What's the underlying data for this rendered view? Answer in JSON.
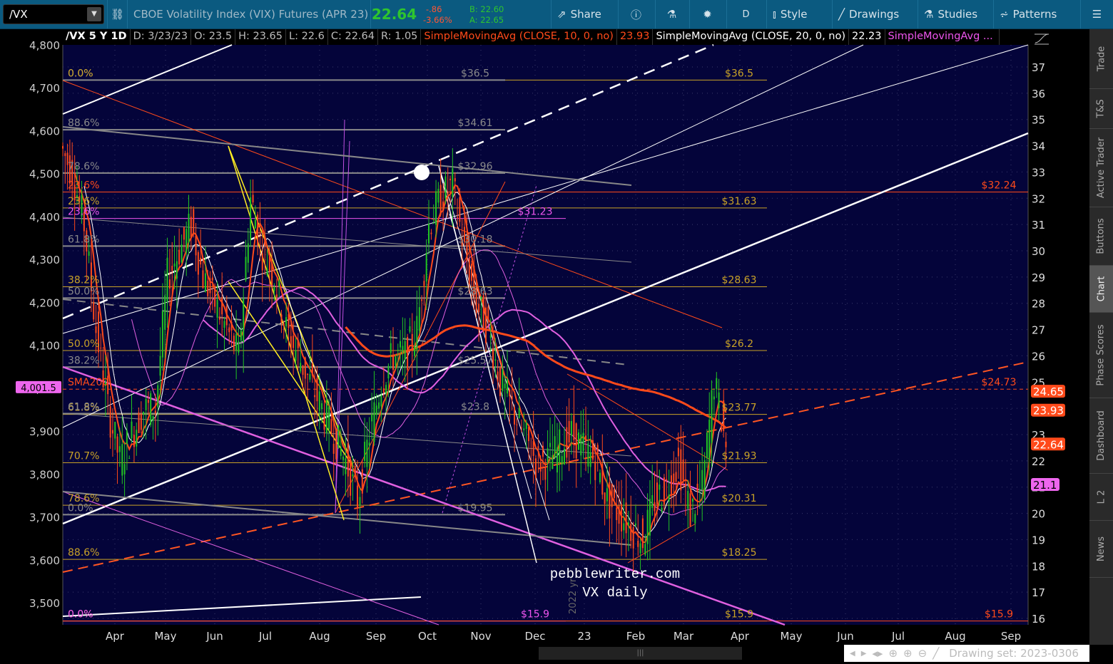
{
  "toolbar": {
    "symbol": "/VX",
    "description": "CBOE Volatility Index (VIX) Futures (APR 23)",
    "last": "22.64",
    "change": "-.86",
    "change_pct": "-3.66%",
    "bid": "B: 22.60",
    "ask": "A: 22.65",
    "share": "Share",
    "aggregation": "D",
    "style": "Style",
    "drawings": "Drawings",
    "studies": "Studies",
    "patterns": "Patterns"
  },
  "header": {
    "title": "/VX 5 Y 1D",
    "date": "D: 3/23/23",
    "open": "O: 23.5",
    "high": "H: 23.65",
    "low": "L: 22.6",
    "close": "C: 22.64",
    "range": "R: 1.05",
    "sma10_label": "SimpleMovingAvg (CLOSE, 10, 0, no)",
    "sma10_value": "23.93",
    "sma20_label": "SimpleMovingAvg (CLOSE, 20, 0, no)",
    "sma20_value": "22.23",
    "sma3_label": "SimpleMovingAvg ..."
  },
  "sidebar": [
    "Trade",
    "T&S",
    "Active Trader",
    "Buttons",
    "Chart",
    "Phase Scores",
    "Dashboard",
    "L 2",
    "News"
  ],
  "bottom": {
    "drawing_set": "Drawing set: 2023-0306"
  },
  "colors": {
    "bg": "#04043a",
    "up": "#22c322",
    "down": "#ff4a1a",
    "sma10": "#ff4a1a",
    "sma20": "#ffffff",
    "sma_magenta": "#e060e0",
    "fib_gold": "#c9a227",
    "fib_gray": "#8a8a8a"
  },
  "chart_data": {
    "type": "candlestick",
    "title": "/VX 5 Y 1D",
    "annotations": {
      "watermark": "pebblewriter.com",
      "subtitle": "VX daily",
      "year_marker": "2022 yr"
    },
    "x_ticks": [
      "Apr",
      "May",
      "Jun",
      "Jul",
      "Aug",
      "Sep",
      "Oct",
      "Nov",
      "Dec",
      "23",
      "Feb",
      "Mar",
      "Apr",
      "May",
      "Jun",
      "Jul",
      "Aug",
      "Sep"
    ],
    "right_axis": {
      "ticks": [
        16,
        17,
        18,
        19,
        20,
        21,
        22,
        23,
        24,
        25,
        26,
        27,
        28,
        29,
        30,
        31,
        32,
        33,
        34,
        35,
        36,
        37
      ],
      "range": [
        15.9,
        37.8
      ]
    },
    "left_axis": {
      "ticks": [
        "3,500",
        "3,600",
        "3,700",
        "3,800",
        "3,900",
        "4,000",
        "4,100",
        "4,200",
        "4,300",
        "4,400",
        "4,500",
        "4,600",
        "4,700",
        "4,800"
      ],
      "range": [
        3450,
        4800
      ],
      "marker": "4,001.5"
    },
    "price_tags": [
      {
        "value": "24.65",
        "color": "#ff4a1a"
      },
      {
        "value": "23.93",
        "color": "#ff4a1a"
      },
      {
        "value": "22.64",
        "color": "#ff4a1a"
      },
      {
        "value": "21.1",
        "color": "#ee66ee"
      }
    ],
    "weekly_closes": {
      "dates": [
        "2022-03-01",
        "2022-03-08",
        "2022-03-15",
        "2022-03-22",
        "2022-03-29",
        "2022-04-05",
        "2022-04-12",
        "2022-04-19",
        "2022-04-26",
        "2022-05-03",
        "2022-05-10",
        "2022-05-17",
        "2022-05-24",
        "2022-05-31",
        "2022-06-07",
        "2022-06-14",
        "2022-06-21",
        "2022-06-28",
        "2022-07-05",
        "2022-07-12",
        "2022-07-19",
        "2022-07-26",
        "2022-08-02",
        "2022-08-09",
        "2022-08-16",
        "2022-08-23",
        "2022-08-30",
        "2022-09-06",
        "2022-09-13",
        "2022-09-20",
        "2022-09-27",
        "2022-10-04",
        "2022-10-11",
        "2022-10-18",
        "2022-10-25",
        "2022-11-01",
        "2022-11-08",
        "2022-11-15",
        "2022-11-22",
        "2022-11-29",
        "2022-12-06",
        "2022-12-13",
        "2022-12-20",
        "2022-12-27",
        "2023-01-03",
        "2023-01-10",
        "2023-01-17",
        "2023-01-24",
        "2023-01-31",
        "2023-02-07",
        "2023-02-14",
        "2023-02-21",
        "2023-02-28",
        "2023-03-07",
        "2023-03-14",
        "2023-03-21"
      ],
      "close": [
        33,
        31,
        27,
        24,
        22,
        23,
        24,
        24,
        29,
        30,
        31,
        29,
        28,
        27,
        26,
        32,
        30,
        29,
        27,
        26,
        25,
        24,
        23,
        22,
        20.5,
        23,
        25,
        26,
        26,
        27,
        31,
        32,
        32.5,
        30,
        28,
        27,
        25,
        24,
        23,
        22,
        22,
        22.5,
        23,
        22.5,
        22,
        20.5,
        20,
        19.5,
        19,
        20.5,
        21,
        22,
        20,
        21,
        25,
        22.64
      ]
    },
    "levels": [
      {
        "price": 36.5,
        "left": "0.0%",
        "right": "$36.5",
        "kind": "gray"
      },
      {
        "price": 36.5,
        "left": "0.0%",
        "right": "$36.5",
        "kind": "gold"
      },
      {
        "price": 34.61,
        "left": "88.6%",
        "right": "$34.61",
        "kind": "gray"
      },
      {
        "price": 32.96,
        "left": "78.6%",
        "right": "$32.96",
        "kind": "gray"
      },
      {
        "price": 32.24,
        "left": "23.6%",
        "right": "$32.24",
        "kind": "red"
      },
      {
        "price": 31.63,
        "left": "23.6%",
        "right": "$31.63",
        "kind": "gold"
      },
      {
        "price": 31.23,
        "left": "23.6%",
        "right": "$31.23",
        "kind": "magenta"
      },
      {
        "price": 30.18,
        "left": "61.8%",
        "right": "$30.18",
        "kind": "gray"
      },
      {
        "price": 28.63,
        "left": "38.2%",
        "right": "$28.63",
        "kind": "gold"
      },
      {
        "price": 28.2,
        "left": "50.0%",
        "right": "$28.63",
        "kind": "gray"
      },
      {
        "price": 26.2,
        "left": "50.0%",
        "right": "$26.2",
        "kind": "gold"
      },
      {
        "price": 25.57,
        "left": "38.2%",
        "right": "$25.57",
        "kind": "gray"
      },
      {
        "price": 24.73,
        "left": "SMA200",
        "right": "$24.73",
        "kind": "red"
      },
      {
        "price": 23.77,
        "left": "61.8%",
        "right": "$23.77",
        "kind": "gold"
      },
      {
        "price": 23.8,
        "left": "61.8%",
        "right": "$23.8",
        "kind": "gray"
      },
      {
        "price": 21.93,
        "left": "70.7%",
        "right": "$21.93",
        "kind": "gold"
      },
      {
        "price": 20.31,
        "left": "78.6%",
        "right": "$20.31",
        "kind": "gold"
      },
      {
        "price": 19.95,
        "left": "0.0%",
        "right": "$19.95",
        "kind": "gray"
      },
      {
        "price": 18.25,
        "left": "88.6%",
        "right": "$18.25",
        "kind": "gold"
      },
      {
        "price": 15.9,
        "left": "0.0%",
        "right": "$15.9",
        "kind": "gold"
      },
      {
        "price": 15.9,
        "left": "0.0%",
        "right": "$15.9",
        "kind": "magenta"
      },
      {
        "price": 15.9,
        "left": "",
        "right": "$15.9",
        "kind": "red"
      }
    ]
  }
}
